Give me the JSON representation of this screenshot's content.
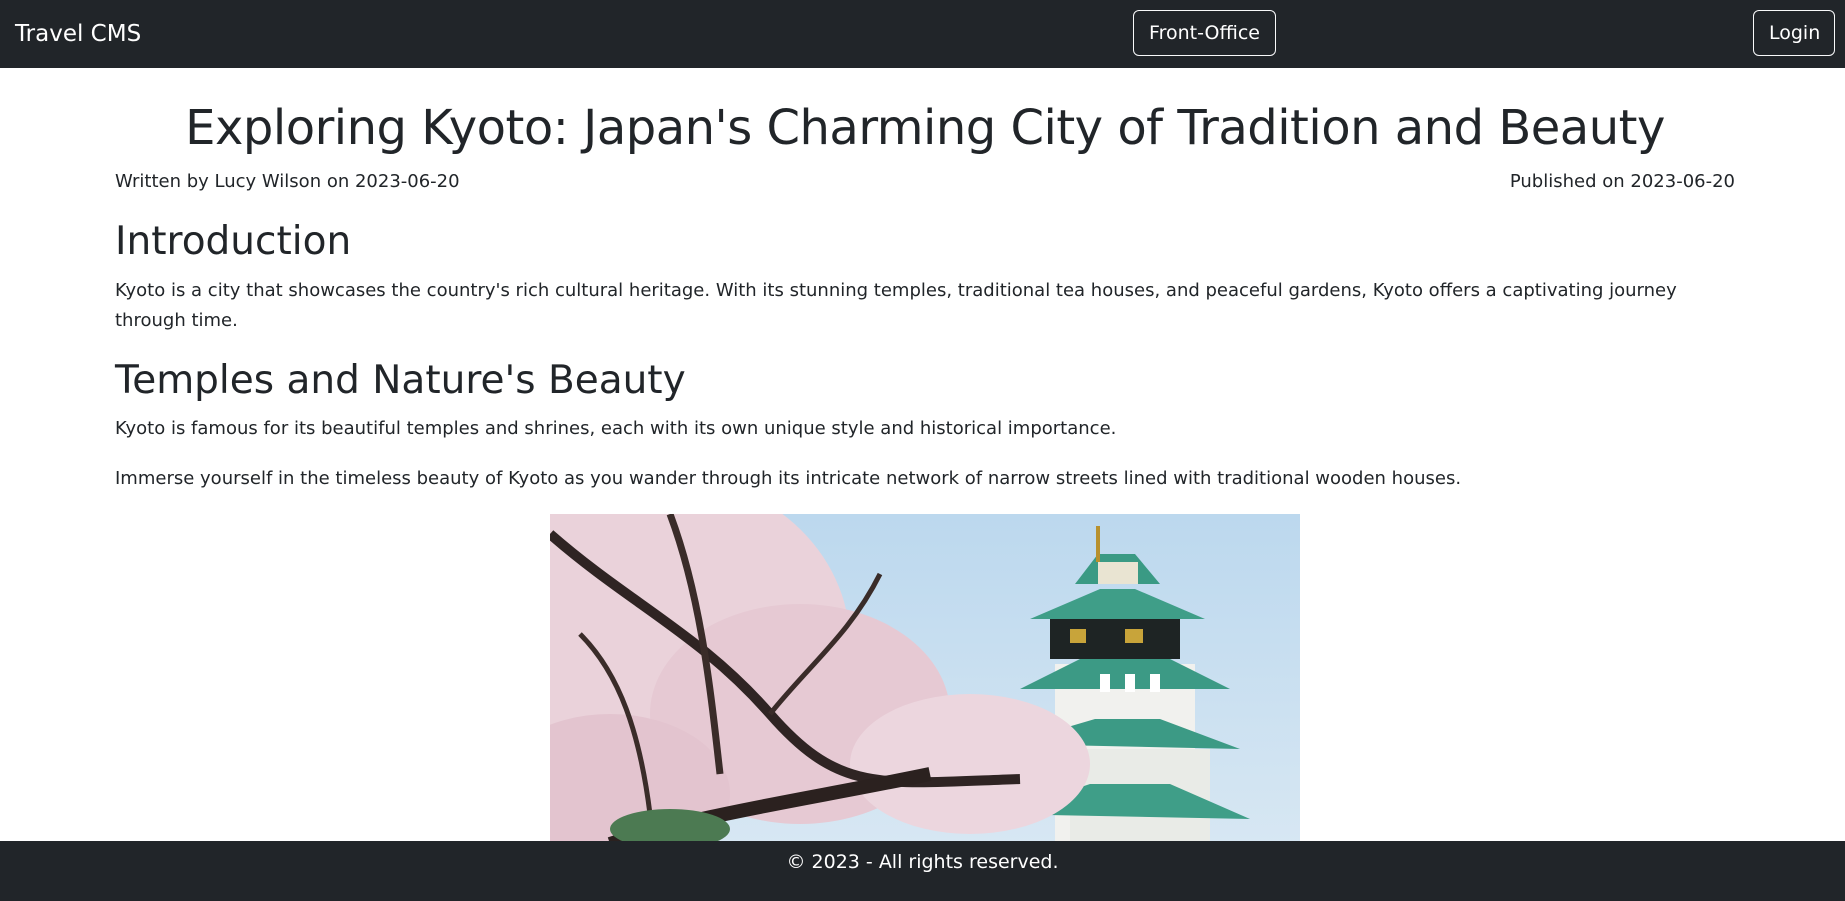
{
  "navbar": {
    "brand": "Travel CMS",
    "front_office_label": "Front-Office",
    "login_label": "Login"
  },
  "article": {
    "title": "Exploring Kyoto: Japan's Charming City of Tradition and Beauty",
    "byline": "Written by Lucy Wilson on 2023-06-20",
    "published": "Published on 2023-06-20",
    "sections": [
      {
        "heading": "Introduction",
        "paragraphs": [
          "Kyoto is a city that showcases the country's rich cultural heritage. With its stunning temples, traditional tea houses, and peaceful gardens, Kyoto offers a captivating journey through time."
        ]
      },
      {
        "heading": "Temples and Nature's Beauty",
        "paragraphs": [
          "Kyoto is famous for its beautiful temples and shrines, each with its own unique style and historical importance.",
          "Immerse yourself in the timeless beauty of Kyoto as you wander through its intricate network of narrow streets lined with traditional wooden houses."
        ]
      }
    ]
  },
  "footer": {
    "text": "© 2023 - All rights reserved."
  },
  "colors": {
    "navbar_bg": "#212529",
    "text": "#212529",
    "sky": "#c4ddef",
    "blossom": "#e9cfd8",
    "roof_green": "#3f9a86"
  }
}
